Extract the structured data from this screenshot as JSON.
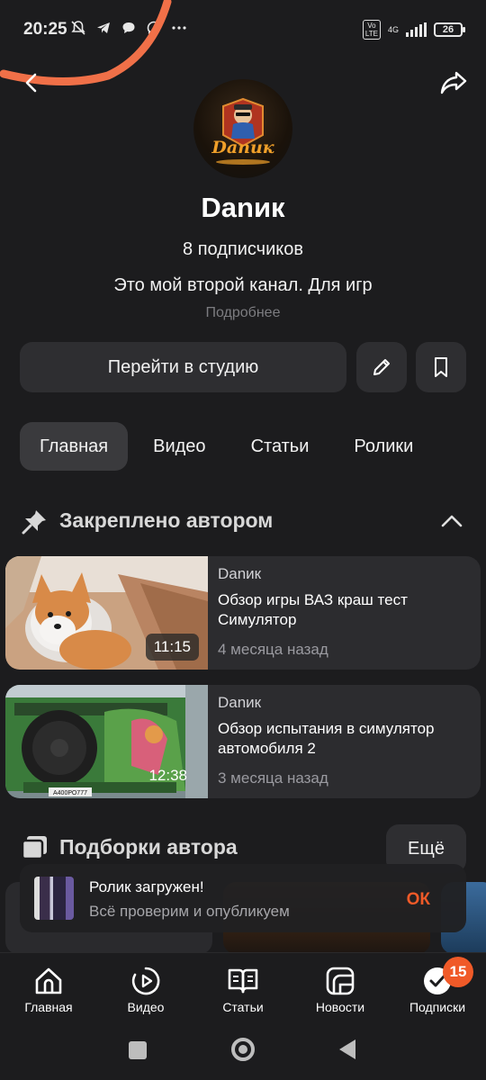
{
  "status_bar": {
    "time": "20:25",
    "network": "4G",
    "volte": "Vo\nLTE",
    "battery": "26"
  },
  "channel": {
    "name": "Danик",
    "avatar_text": "Danик",
    "subscribers": "8 подписчиков",
    "description": "Это мой второй канал. Для игр",
    "more_link": "Подробнее"
  },
  "actions": {
    "studio_label": "Перейти в студию"
  },
  "tabs": [
    {
      "label": "Главная",
      "active": true
    },
    {
      "label": "Видео",
      "active": false
    },
    {
      "label": "Статьи",
      "active": false
    },
    {
      "label": "Ролики",
      "active": false
    }
  ],
  "pinned": {
    "title": "Закреплено автором",
    "videos": [
      {
        "author": "Danик",
        "title": "Обзор игры ВАЗ краш тест Симулятор",
        "age": "4 месяца назад",
        "duration": "11:15"
      },
      {
        "author": "Danик",
        "title": "Обзор испытания в симулятор автомобиля 2",
        "age": "3 месяца назад",
        "duration": "12:38",
        "plate": "А400РО777"
      }
    ]
  },
  "collections": {
    "title": "Подборки автора",
    "more_label": "Ещё"
  },
  "toast": {
    "title": "Ролик загружен!",
    "subtitle": "Всё проверим и опубликуем",
    "action": "ОК"
  },
  "bottom_nav": {
    "items": [
      {
        "label": "Главная",
        "icon": "home-icon"
      },
      {
        "label": "Видео",
        "icon": "video-play-icon"
      },
      {
        "label": "Статьи",
        "icon": "book-icon"
      },
      {
        "label": "Новости",
        "icon": "news-icon"
      },
      {
        "label": "Подписки",
        "icon": "subscriptions-icon"
      }
    ],
    "subscriptions_badge": "15"
  },
  "colors": {
    "background": "#1c1c1e",
    "card": "#2c2c2f",
    "accent": "#f05a28"
  }
}
